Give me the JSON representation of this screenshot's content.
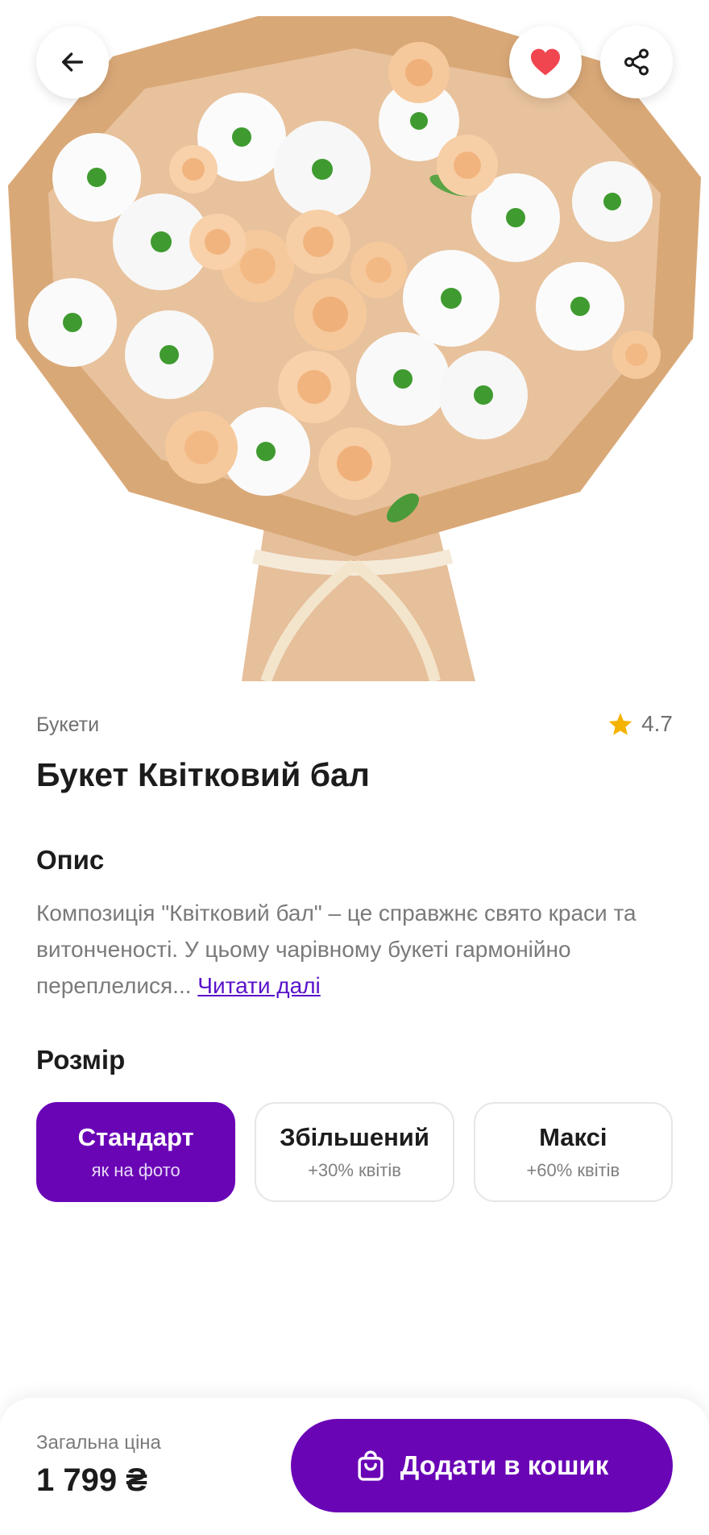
{
  "product": {
    "category": "Букети",
    "rating": "4.7",
    "title": "Букет Квітковий бал",
    "favorite": true
  },
  "description": {
    "heading": "Опис",
    "text": "Композиція \"Квітковий бал\" – це справжнє свято краси та витонченості. У цьому чарівному букеті гармонійно переплелися...",
    "read_more": "Читати далі"
  },
  "size": {
    "heading": "Розмір",
    "options": [
      {
        "title": "Стандарт",
        "subtitle": "як на фото",
        "selected": true
      },
      {
        "title": "Збільшений",
        "subtitle": "+30% квітів",
        "selected": false
      },
      {
        "title": "Максі",
        "subtitle": "+60% квітів",
        "selected": false
      }
    ]
  },
  "footer": {
    "total_label": "Загальна ціна",
    "total_price": "1 799 ₴",
    "cart_button": "Додати в кошик"
  },
  "icons": {
    "back": "arrow-left-icon",
    "favorite": "heart-icon",
    "share": "share-icon",
    "rating": "star-icon",
    "cart": "shopping-bag-icon"
  },
  "colors": {
    "accent": "#6a05b6",
    "heart": "#f0464f",
    "star": "#f5b301"
  }
}
